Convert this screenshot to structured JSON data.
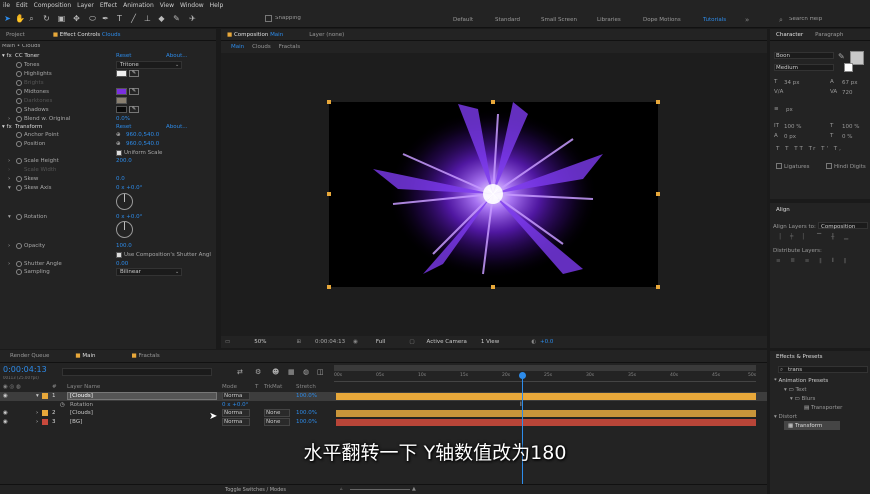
{
  "menu": [
    "ile",
    "Edit",
    "Composition",
    "Layer",
    "Effect",
    "Animation",
    "View",
    "Window",
    "Help"
  ],
  "toolbar": {
    "snapping": "Snapping",
    "workspaces": [
      "Default",
      "Standard",
      "Small Screen",
      "Libraries",
      "Dope Motions",
      "Tutorials"
    ],
    "active_workspace": "Tutorials",
    "search_placeholder": "Search Help"
  },
  "effect_controls": {
    "tabs": [
      "Project",
      "Effect Controls"
    ],
    "layer_name": "Clouds",
    "breadcrumb": "Main • Clouds",
    "cc_toner": {
      "name": "CC Toner",
      "reset": "Reset",
      "about": "About...",
      "tones_label": "Tones",
      "tones_value": "Tritone",
      "highlights": "Highlights",
      "brights": "Brights",
      "midtones": "Midtones",
      "darktones": "Darktones",
      "shadows": "Shadows",
      "blend_label": "Blend w. Original",
      "blend_value": "0.0%"
    },
    "transform": {
      "name": "Transform",
      "reset": "Reset",
      "about": "About...",
      "anchor_label": "Anchor Point",
      "anchor_value": "960.0,540.0",
      "position_label": "Position",
      "position_value": "960.0,540.0",
      "uniform_scale": "Uniform Scale",
      "scale_height_label": "Scale Height",
      "scale_height_value": "200.0",
      "scale_width_label": "Scale Width",
      "skew_label": "Skew",
      "skew_value": "0.0",
      "skew_axis_label": "Skew Axis",
      "skew_axis_value": "0 x +0.0°",
      "rotation_label": "Rotation",
      "rotation_value": "0 x +0.0°",
      "opacity_label": "Opacity",
      "opacity_value": "100.0",
      "use_shutter": "Use Composition's Shutter Angl",
      "shutter_label": "Shutter Angle",
      "shutter_value": "0.00",
      "sampling_label": "Sampling",
      "sampling_value": "Bilinear"
    }
  },
  "composition": {
    "tab": "Composition",
    "tab_name": "Main",
    "layer_tab": "Layer (none)",
    "breadcrumbs": [
      "Main",
      "Clouds",
      "Fractals"
    ],
    "zoom": "50%",
    "timecode": "0:00:04:13",
    "resolution": "Full",
    "camera": "Active Camera",
    "view": "1 View",
    "exposure": "+0.0"
  },
  "timeline": {
    "tabs": [
      "Render Queue",
      "Main",
      "Fractals"
    ],
    "timecode": "0:00:04:13",
    "frames": "00113 (25.00 fps)",
    "search_placeholder": "",
    "columns": [
      "Layer Name",
      "Mode",
      "T",
      "TrkMat",
      "Stretch"
    ],
    "ruler": [
      "00s",
      "05s",
      "10s",
      "15s",
      "20s",
      "25s",
      "30s",
      "35s",
      "40s",
      "45s",
      "50s"
    ],
    "playhead_fraction": 0.45,
    "layers": [
      {
        "index": "1",
        "name": "[Clouds]",
        "mode": "Norma",
        "trkmat": "",
        "stretch": "100.0%",
        "color": "#e8a83a"
      },
      {
        "index": "2",
        "name": "[Clouds]",
        "mode": "Norma",
        "trkmat": "None",
        "stretch": "100.0%",
        "color": "#e8a83a"
      },
      {
        "index": "3",
        "name": "[BG]",
        "mode": "Norma",
        "trkmat": "None",
        "stretch": "100.0%",
        "color": "#c8493c"
      }
    ],
    "sub_property": "Rotation",
    "sub_value": "0 x +0.0°",
    "toggle_label": "Toggle Switches / Modes"
  },
  "character": {
    "tabs": [
      "Character",
      "Paragraph"
    ],
    "font": "Boon",
    "style": "Medium",
    "size": "34 px",
    "leading": "67 px",
    "tracking": "720",
    "unit": "px",
    "vscale": "100 %",
    "hscale": "100 %",
    "baseline": "0 px",
    "tsume": "0 %",
    "ligatures": "Ligatures",
    "hindi": "Hindi Digits"
  },
  "align": {
    "title": "Align",
    "align_to_label": "Align Layers to:",
    "align_to_value": "Composition",
    "distribute_label": "Distribute Layers:"
  },
  "effects_presets": {
    "title": "Effects & Presets",
    "search_value": "trans",
    "tree": [
      "* Animation Presets",
      "Text",
      "Blurs",
      "Transporter",
      "Distort",
      "Transform"
    ]
  },
  "subtitle": "水平翻转一下 Y轴数值改为180",
  "colors": {
    "accent": "#2d8ceb",
    "layer_orange": "#e8a83a",
    "layer_red": "#c8493c",
    "midtones_swatch": "#7a2fe0"
  }
}
